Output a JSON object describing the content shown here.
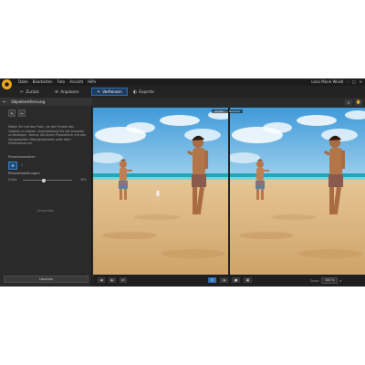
{
  "app": {
    "menu": [
      "Datei",
      "Bearbeiten",
      "Foto",
      "Ansicht",
      "Hilfe"
    ],
    "project_name": "",
    "user": "Lena Marie Weiss",
    "window_controls": [
      "?",
      "–",
      "□",
      "×"
    ]
  },
  "toolbar": {
    "back_label": "Zurück",
    "adjust_label": "Anpassen",
    "retouch_label": "Verfeinern",
    "effects_label": "Experte",
    "active": "retouch"
  },
  "leftpanel": {
    "title": "Objektentfernung",
    "description": "Malen Sie auf das Foto, um die Punkte des Objekts zu setzen. Anschließend Sie die Auswahl zu bewegen. Rorme Sie Ihrem Pinselstrich mit den Vorgabenden Ubergeordneten oder dem Inhaltsstock an.",
    "brush_section": "Pinselauswahlen",
    "brush_value": "1",
    "settings_section": "Pinseleinstellungen",
    "slider_min": "Größe",
    "slider_max": "40%",
    "slider_fraction": 0.42,
    "apply_label": "Anwenden",
    "delete_label": "Löschen"
  },
  "preview": {
    "before_label": "Vorher",
    "after_label": "Nachher",
    "zoom_label": "Zoom:",
    "zoom_value": "100 %",
    "zoom_dropdown": "▾"
  },
  "colors": {
    "accent": "#2e6fb8",
    "logo": "#f0a81c",
    "sky": "#4ea6dd",
    "sea": "#1fa9b8",
    "sand": "#e2bf8a"
  }
}
